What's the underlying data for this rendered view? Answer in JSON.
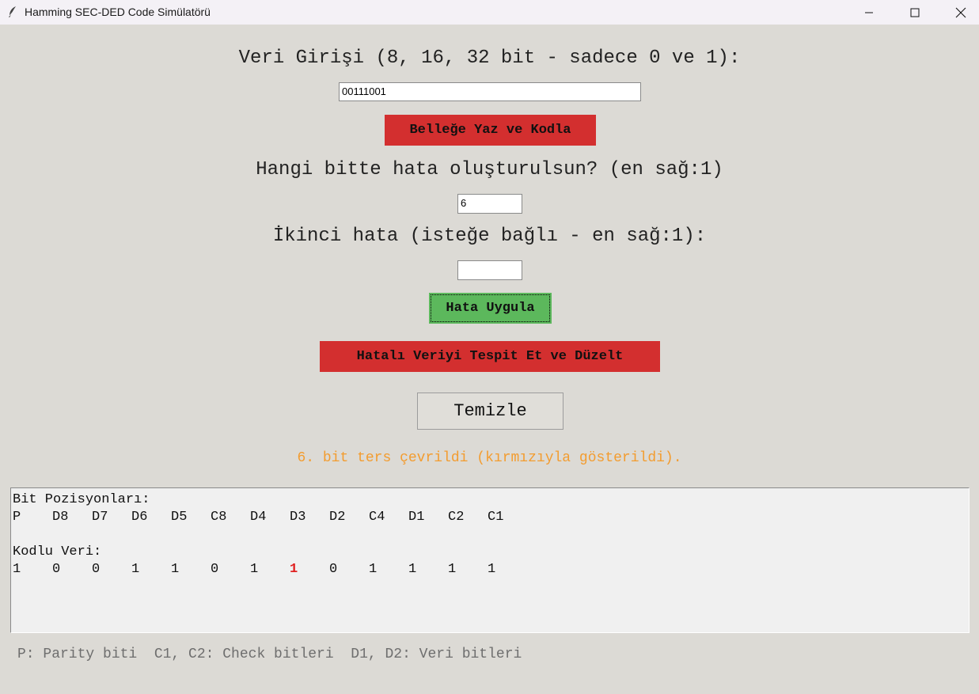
{
  "window": {
    "title": "Hamming SEC-DED Code Simülatörü"
  },
  "form": {
    "data_label": "Veri Girişi (8, 16, 32 bit - sadece 0 ve 1):",
    "data_value": "00111001",
    "encode_button": "Belleğe Yaz ve Kodla",
    "error_bit_label": "Hangi bitte hata oluşturulsun? (en sağ:1)",
    "error_bit_value": "6",
    "second_error_label": "İkinci hata (isteğe bağlı - en sağ:1):",
    "second_error_value": "",
    "apply_button": "Hata Uygula",
    "detect_button": "Hatalı Veriyi Tespit Et ve Düzelt",
    "clear_button": "Temizle"
  },
  "status": {
    "message": "6. bit ters çevrildi (kırmızıyla gösterildi).",
    "color": "#f39c2f"
  },
  "output": {
    "positions_title": "Bit Pozisyonları:",
    "positions": [
      "P",
      "D8",
      "D7",
      "D6",
      "D5",
      "C8",
      "D4",
      "D3",
      "D2",
      "C4",
      "D1",
      "C2",
      "C1"
    ],
    "coded_title": "Kodlu Veri:",
    "coded_bits": [
      "1",
      "0",
      "0",
      "1",
      "1",
      "0",
      "1",
      "1",
      "0",
      "1",
      "1",
      "1",
      "1"
    ],
    "flipped_index": 7,
    "flipped_color": "#e02020"
  },
  "legend": {
    "text": "P: Parity biti  C1, C2: Check bitleri  D1, D2: Veri bitleri"
  },
  "colors": {
    "background": "#dcdad5",
    "red_button": "#d32f2f",
    "green_button": "#5cb85c"
  },
  "icons": [
    "feather-icon",
    "minimize-icon",
    "maximize-icon",
    "close-icon"
  ]
}
